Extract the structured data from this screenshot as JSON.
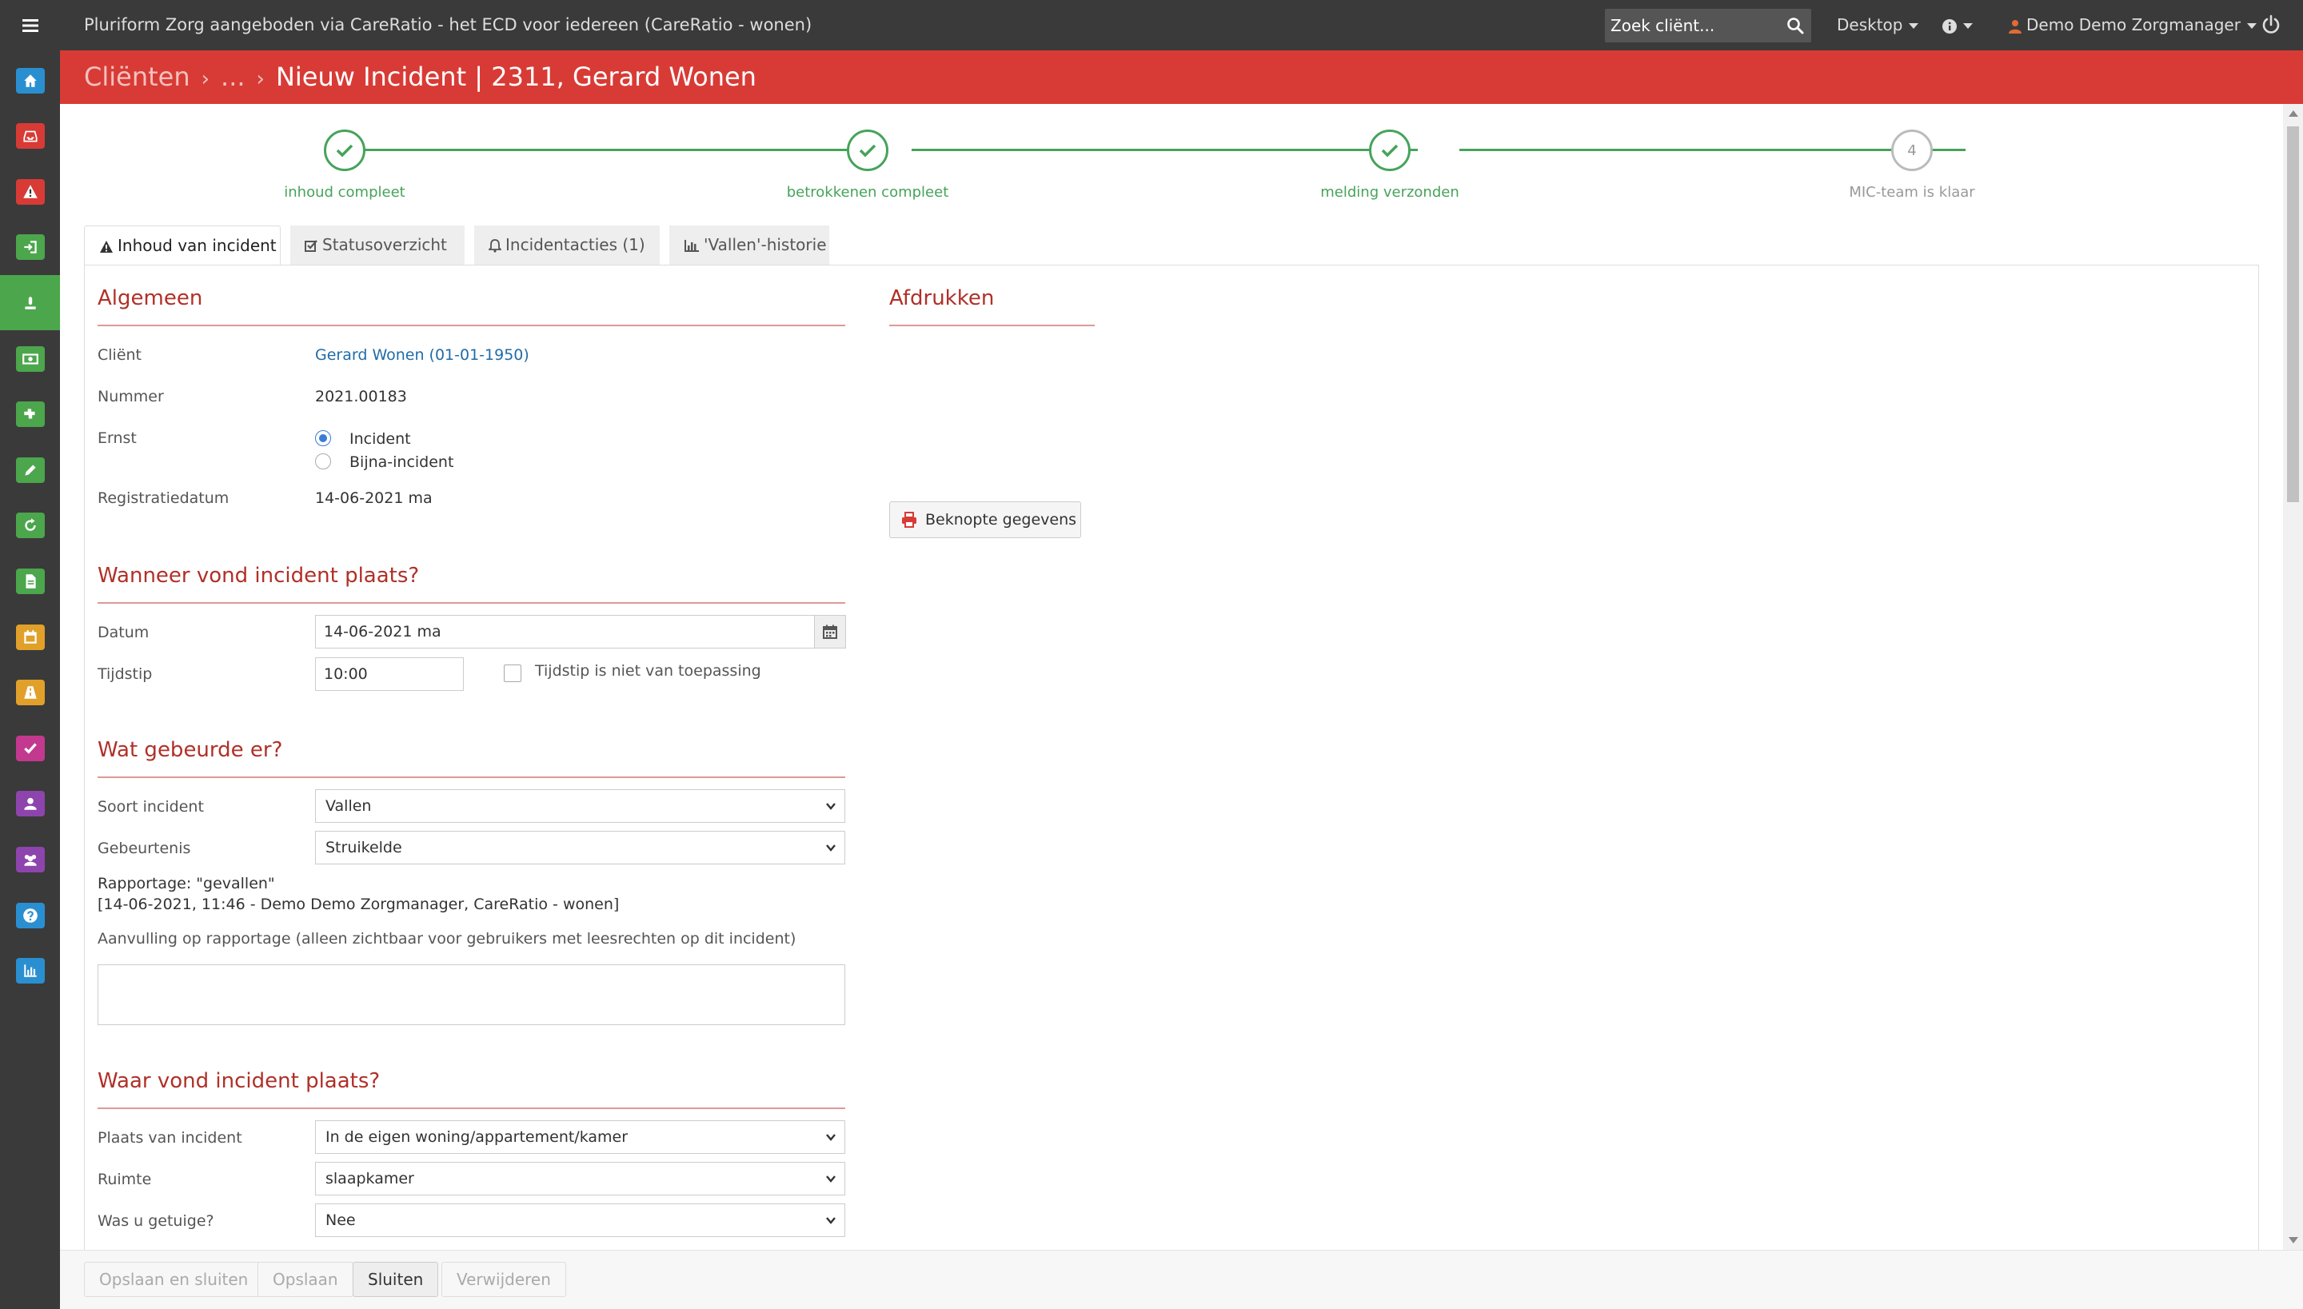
{
  "app": {
    "title": "Pluriform Zorg aangeboden via CareRatio - het ECD voor iedereen  (CareRatio - wonen)",
    "search_placeholder": "Zoek cliënt...",
    "menu_desktop": "Desktop",
    "menu_user": "Demo Demo Zorgmanager"
  },
  "sidebar": {
    "items": [
      {
        "icon": "home-icon",
        "color": "#2a8fd0"
      },
      {
        "icon": "inbox-icon",
        "color": "#d83b35"
      },
      {
        "icon": "warning-icon",
        "color": "#d83b35"
      },
      {
        "icon": "sign-in-icon",
        "color": "#4ca64c"
      },
      {
        "icon": "incident-icon",
        "color": "#4ca64c",
        "active": true
      },
      {
        "icon": "money-icon",
        "color": "#4ca64c"
      },
      {
        "icon": "puzzle-icon",
        "color": "#4ca64c"
      },
      {
        "icon": "pencil-icon",
        "color": "#4ca64c"
      },
      {
        "icon": "refresh-icon",
        "color": "#4ca64c"
      },
      {
        "icon": "document-icon",
        "color": "#4ca64c"
      },
      {
        "icon": "calendar-icon",
        "color": "#e0a02a"
      },
      {
        "icon": "road-icon",
        "color": "#e0a02a"
      },
      {
        "icon": "checkmark-icon",
        "color": "#c2398f"
      },
      {
        "icon": "user-icon",
        "color": "#8e44ad"
      },
      {
        "icon": "group-icon",
        "color": "#8e44ad"
      },
      {
        "icon": "help-icon",
        "color": "#2a8fd0"
      },
      {
        "icon": "chart-icon",
        "color": "#2a8fd0"
      }
    ]
  },
  "breadcrumb": {
    "root": "Cliënten",
    "ellipsis": "...",
    "current": "Nieuw Incident | 2311, Gerard Wonen"
  },
  "steps": [
    {
      "label": "inhoud compleet",
      "done": true
    },
    {
      "label": "betrokkenen compleet",
      "done": true
    },
    {
      "label": "melding verzonden",
      "done": true
    },
    {
      "label": "MIC-team is klaar",
      "done": false,
      "number": "4"
    }
  ],
  "tabs": [
    {
      "label": "Inhoud van incident",
      "icon": "warning-icon"
    },
    {
      "label": "Statusoverzicht",
      "icon": "checkbox-icon"
    },
    {
      "label": "Incidentacties (1)",
      "icon": "bell-icon"
    },
    {
      "label": "'Vallen'-historie",
      "icon": "bar-chart-icon"
    }
  ],
  "algemeen": {
    "title": "Algemeen",
    "client_label": "Cliënt",
    "client_value": "Gerard Wonen (01-01-1950)",
    "nummer_label": "Nummer",
    "nummer_value": "2021.00183",
    "ernst_label": "Ernst",
    "ernst_options": [
      "Incident",
      "Bijna-incident"
    ],
    "ernst_selected": "Incident",
    "registratiedatum_label": "Registratiedatum",
    "registratiedatum_value": "14-06-2021 ma"
  },
  "afdrukken": {
    "title": "Afdrukken",
    "button_label": "Beknopte gegevens"
  },
  "wanneer": {
    "title": "Wanneer vond incident plaats?",
    "datum_label": "Datum",
    "datum_value": "14-06-2021 ma",
    "tijdstip_label": "Tijdstip",
    "tijdstip_value": "10:00",
    "checkbox_label": "Tijdstip is niet van toepassing"
  },
  "wat": {
    "title": "Wat gebeurde er?",
    "soort_label": "Soort incident",
    "soort_value": "Vallen",
    "gebeurtenis_label": "Gebeurtenis",
    "gebeurtenis_value": "Struikelde",
    "rapportage_line1": "Rapportage: \"gevallen\"",
    "rapportage_line2": "[14-06-2021, 11:46 - Demo Demo Zorgmanager, CareRatio - wonen]",
    "aanvulling_label": "Aanvulling op rapportage (alleen zichtbaar voor gebruikers met leesrechten op dit incident)"
  },
  "waar": {
    "title": "Waar vond incident plaats?",
    "plaats_label": "Plaats van incident",
    "plaats_value": "In de eigen woning/appartement/kamer",
    "ruimte_label": "Ruimte",
    "ruimte_value": "slaapkamer",
    "getuige_label": "Was u getuige?",
    "getuige_value": "Nee"
  },
  "footer": {
    "save_close": "Opslaan en sluiten",
    "save": "Opslaan",
    "close": "Sluiten",
    "delete": "Verwijderen"
  }
}
